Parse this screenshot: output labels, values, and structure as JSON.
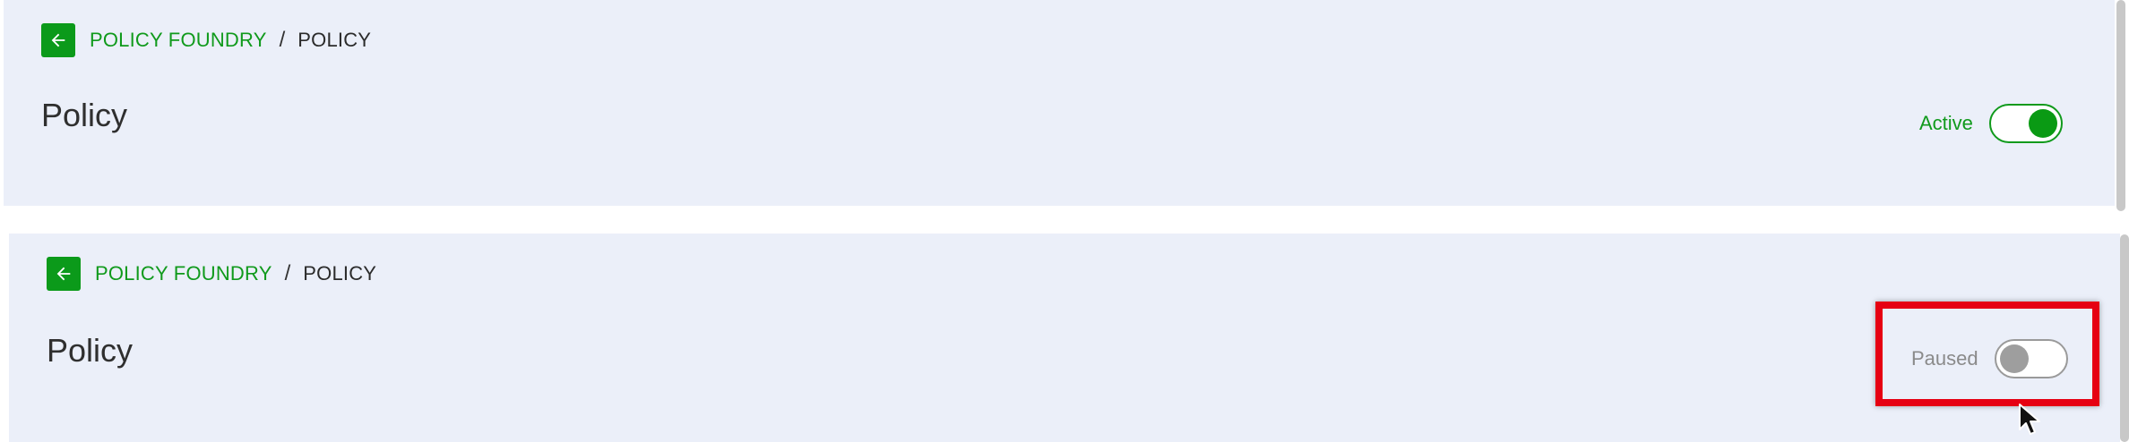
{
  "top_panel": {
    "breadcrumb_parent": "POLICY FOUNDRY",
    "breadcrumb_separator": "/",
    "breadcrumb_current": "POLICY",
    "title": "Policy",
    "status_label": "Active",
    "toggle_state": "on"
  },
  "bottom_panel": {
    "breadcrumb_parent": "POLICY FOUNDRY",
    "breadcrumb_separator": "/",
    "breadcrumb_current": "POLICY",
    "title": "Policy",
    "status_label": "Paused",
    "toggle_state": "off"
  },
  "icons": {
    "back": "arrow-left-icon",
    "cursor": "mouse-pointer-icon"
  },
  "colors": {
    "brand_green": "#109a1c",
    "panel_bg": "#ebeff9",
    "highlight_red": "#e60012",
    "paused_gray": "#8a8a8a"
  }
}
